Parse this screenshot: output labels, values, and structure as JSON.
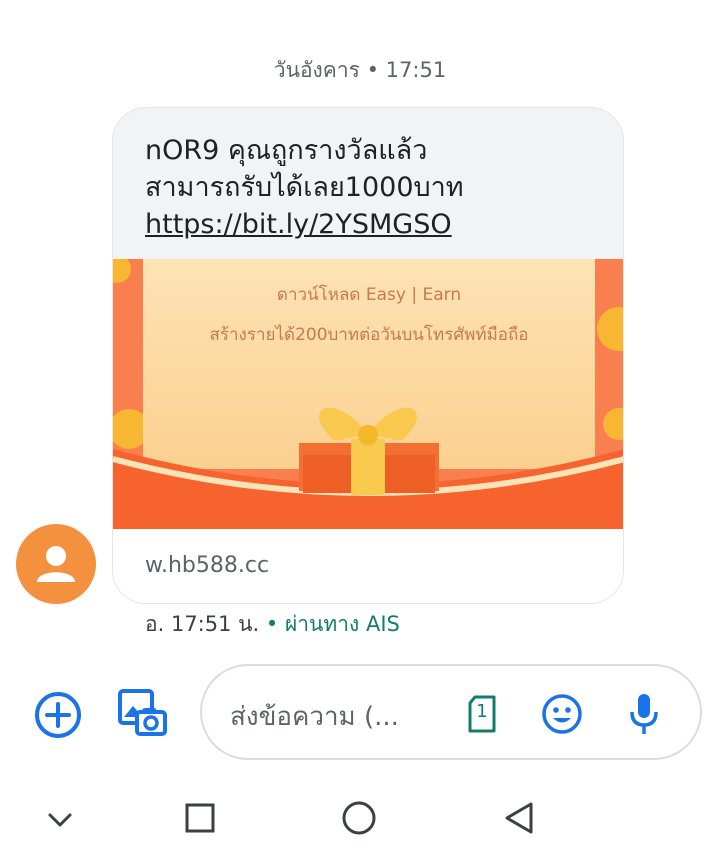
{
  "header": {
    "timestamp": "วันอังคาร • 17:51"
  },
  "message": {
    "line1": "nOR9 คุณถูกรางวัลแล้ว",
    "line2": "สามารถรับได้เลย1000บาท",
    "link": "https://bit.ly/2YSMGSO",
    "preview": {
      "image_line1": "ดาวน์โหลด Easy | Earn",
      "image_line2": "สร้างรายได้200บาทต่อวันบนโทรศัพท์มือถือ",
      "domain": "w.hb588.cc"
    },
    "meta_time": "อ. 17:51 น.",
    "meta_separator": " • ",
    "meta_carrier": "ผ่านทาง AIS"
  },
  "compose": {
    "placeholder": "ส่งข้อความ (...",
    "sim_number": "1"
  },
  "icons": {
    "add": "add-circle-icon",
    "gallery": "gallery-camera-icon",
    "sim": "sim-card-icon",
    "emoji": "emoji-icon",
    "mic": "microphone-icon",
    "nav_down": "chevron-down-icon",
    "nav_recents": "square-icon",
    "nav_home": "circle-icon",
    "nav_back": "triangle-back-icon"
  },
  "colors": {
    "accent_blue": "#1a73e8",
    "avatar_orange": "#f4913f",
    "carrier_green": "#137d6b",
    "sim_green": "#137d6b"
  }
}
